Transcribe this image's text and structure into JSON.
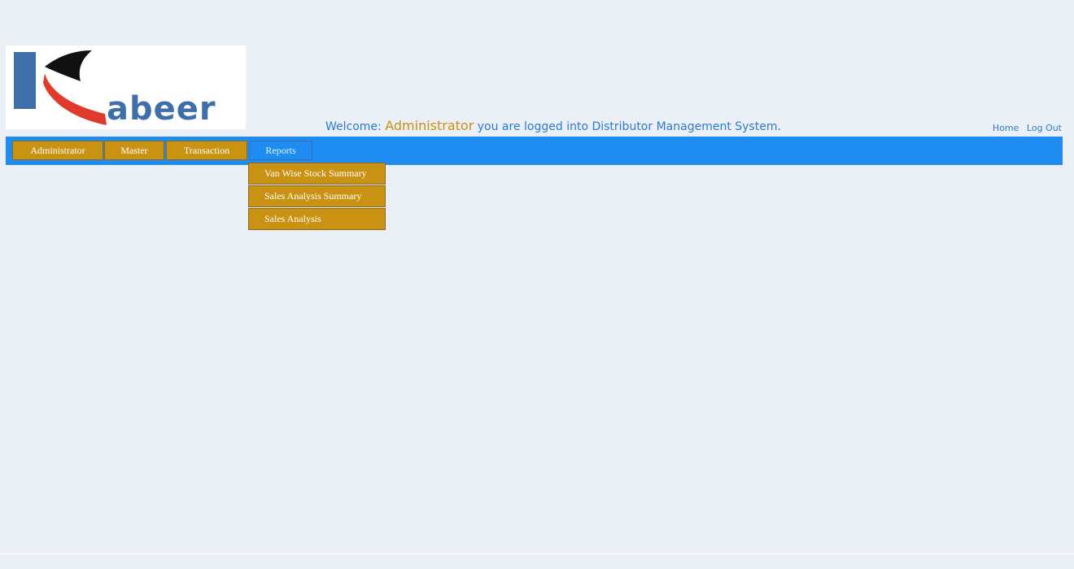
{
  "logo": {
    "text": "abeer",
    "icon": "kabeer-k-logo",
    "colors": {
      "blue": "#3f6fa8",
      "red": "#e03a2c",
      "black": "#111111"
    }
  },
  "header": {
    "welcome_prefix": "Welcome:",
    "user_name": "Administrator",
    "welcome_suffix": "you are logged into Distributor Management System.",
    "links": {
      "home": "Home",
      "logout": "Log Out"
    }
  },
  "menu": {
    "items": [
      {
        "label": "Administrator"
      },
      {
        "label": "Master"
      },
      {
        "label": "Transaction"
      },
      {
        "label": "Reports"
      }
    ],
    "active": "Reports",
    "dropdown": [
      {
        "label": "Van Wise Stock Summary"
      },
      {
        "label": "Sales Analysis Summary"
      },
      {
        "label": "Sales Analysis"
      }
    ]
  },
  "colors": {
    "background": "#ebf0f6",
    "menubar": "#1e8cf0",
    "menu_item": "#c99212",
    "link_blue": "#2d7ad0"
  }
}
